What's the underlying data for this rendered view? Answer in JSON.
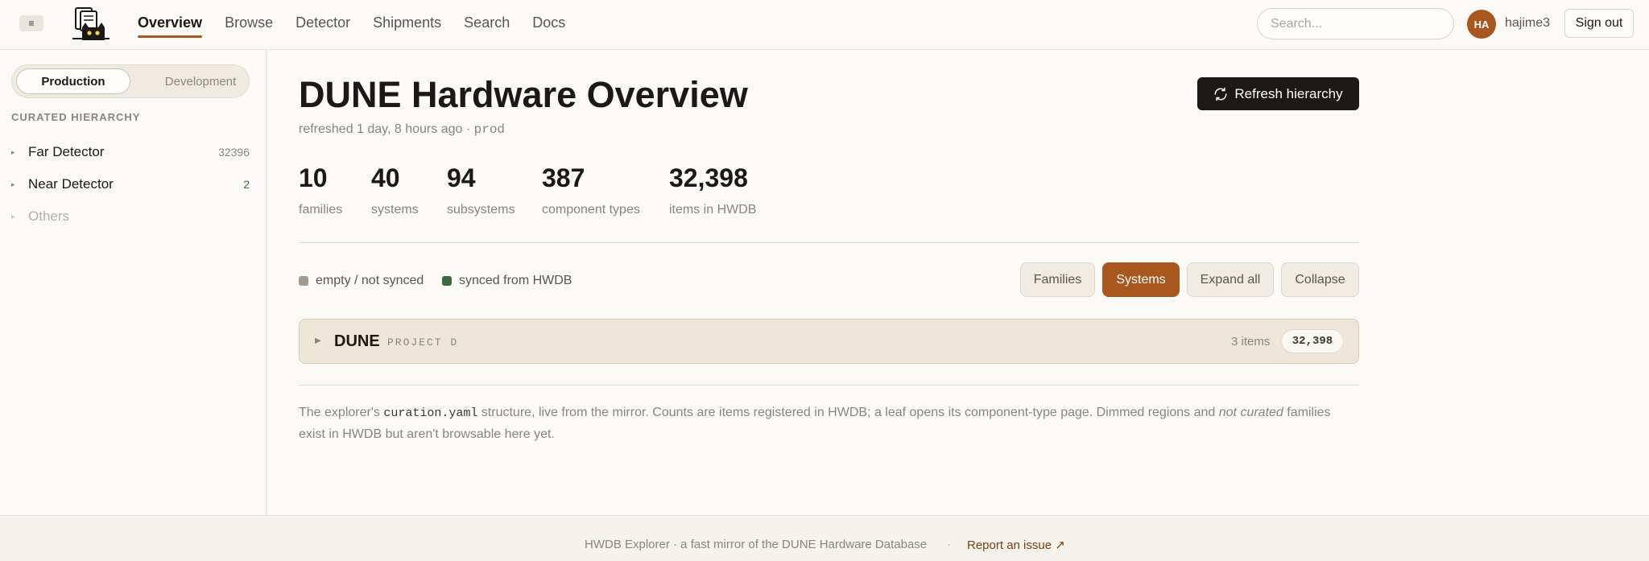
{
  "header": {
    "menu_icon": "≡",
    "nav": [
      "Overview",
      "Browse",
      "Detector",
      "Shipments",
      "Search",
      "Docs"
    ],
    "active_nav": "Overview",
    "search_placeholder": "Search...",
    "avatar_initials": "HA",
    "username": "hajime3",
    "signout_label": "Sign out"
  },
  "sidebar": {
    "env_options": [
      "Production",
      "Development"
    ],
    "active_env": "Production",
    "hierarchy_title": "CURATED HIERARCHY",
    "items": [
      {
        "label": "Far Detector",
        "count": "32396",
        "count_color": "#8b847a"
      },
      {
        "label": "Near Detector",
        "count": "2",
        "count_color": "#3c6a3e"
      },
      {
        "label": "Others",
        "count": "",
        "dimmed": true
      }
    ]
  },
  "main": {
    "title": "DUNE Hardware Overview",
    "refresh_label": "Refresh hierarchy",
    "refreshed_text": "refreshed 1 day, 8 hours ago · ",
    "env_code": "prod",
    "stats": [
      {
        "value": "10",
        "label": "families"
      },
      {
        "value": "40",
        "label": "systems"
      },
      {
        "value": "94",
        "label": "subsystems"
      },
      {
        "value": "387",
        "label": "component types"
      },
      {
        "value": "32,398",
        "label": "items in HWDB"
      }
    ],
    "legend": [
      {
        "label": "empty / not synced",
        "color": "#a29a8c"
      },
      {
        "label": "synced from HWDB",
        "color": "#3c6a3e"
      }
    ],
    "view_buttons": [
      "Families",
      "Systems",
      "Expand all",
      "Collapse"
    ],
    "active_view": "Systems",
    "tree_row": {
      "name": "DUNE",
      "subtitle": "PROJECT D",
      "items_text": "3 items",
      "count": "32,398"
    },
    "footnote": {
      "part1": "The explorer's ",
      "code": "curation.yaml",
      "part2": " structure, live from the mirror. Counts are items registered in HWDB; a leaf opens its component-type page. Dimmed regions and ",
      "emph": "not curated",
      "part3": " families exist in HWDB but aren't browsable here yet."
    }
  },
  "footer": {
    "text": "HWDB Explorer · a fast mirror of the DUNE Hardware Database",
    "separator": "·",
    "link": "Report an issue ↗"
  },
  "colors": {
    "accent": "#a8581e",
    "synced": "#3c6a3e",
    "dark": "#1c1814"
  }
}
